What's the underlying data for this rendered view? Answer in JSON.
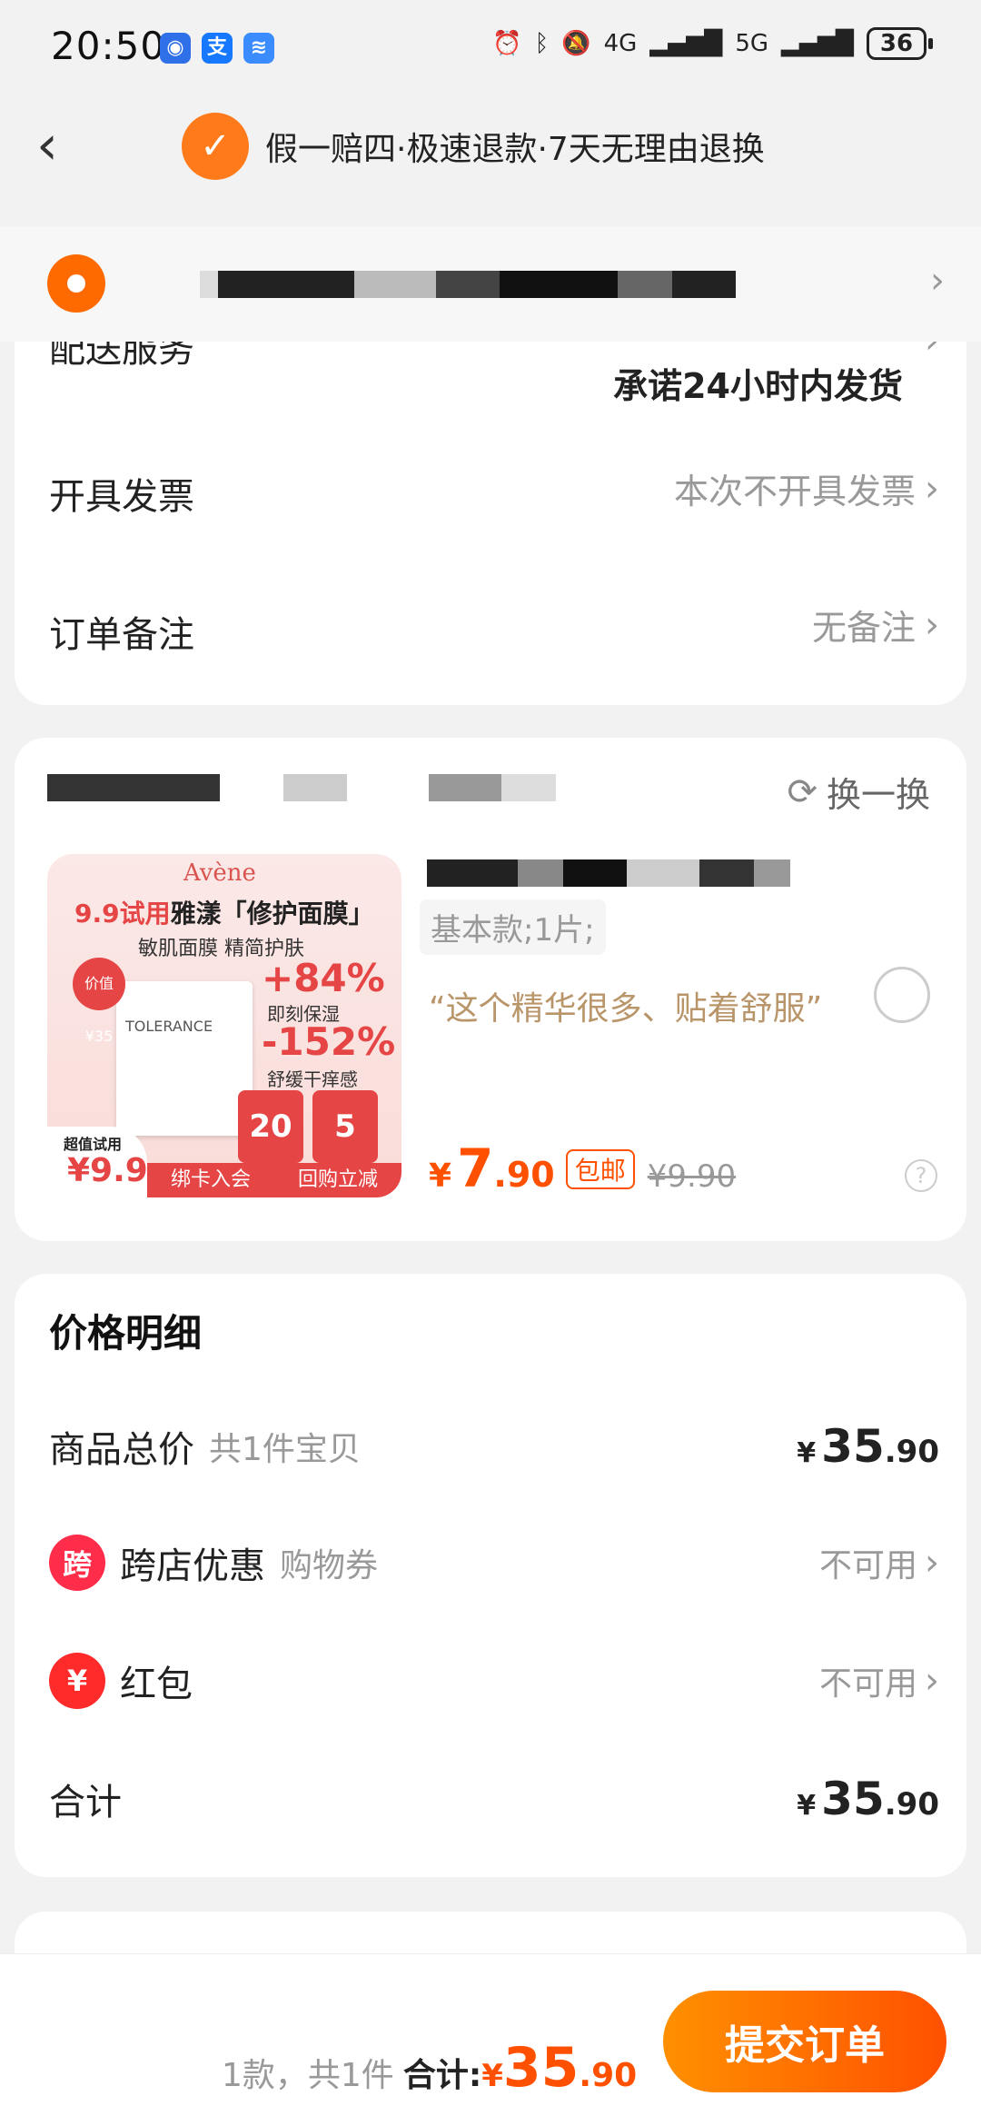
{
  "status_bar": {
    "time": "20:50",
    "network_labels": [
      "4G",
      "5G"
    ],
    "battery": "36",
    "icons": [
      "location-app-icon",
      "alipay-icon",
      "wifi-app-icon",
      "alarm-icon",
      "bluetooth-icon",
      "mute-icon",
      "signal-icon",
      "battery-icon"
    ]
  },
  "header": {
    "guarantee_text": "假一赔四·极速退款·7天无理由退换"
  },
  "delivery_card": {
    "clipped_label": "配送服务",
    "shipping_promise": "承诺24小时内发货",
    "invoice_label": "开具发票",
    "invoice_value": "本次不开具发票",
    "note_label": "订单备注",
    "note_value": "无备注"
  },
  "product_card": {
    "swap_label": "换一换",
    "image": {
      "brand": "Avène",
      "headline_prefix": "9.9试用",
      "headline_main": "雅漾「修护面膜」",
      "subtitle": "敏肌面膜 精简护肤",
      "stat1": "+84%",
      "stat1_label": "即刻保湿",
      "stat2": "-152%",
      "stat2_label": "舒缓干痒感",
      "box_text": "TOLERANCE",
      "price_tag": "价值¥35",
      "coupon1": "20",
      "coupon2": "5",
      "trial_label": "超值试用",
      "trial_value": "¥9.9",
      "footer_left": "绑卡入会",
      "footer_right": "回购立减"
    },
    "variant": "基本款;1片;",
    "review": "“这个精华很多、贴着舒服”",
    "price_yen": "¥",
    "price_int": "7",
    "price_dec": ".90",
    "free_shipping": "包邮",
    "original_price": "¥9.90"
  },
  "price_detail": {
    "title": "价格明细",
    "subtotal_label": "商品总价",
    "subtotal_sub": "共1件宝贝",
    "subtotal_yen": "¥",
    "subtotal_int": "35",
    "subtotal_dec": ".90",
    "cross_store_icon": "跨",
    "cross_store_label": "跨店优惠",
    "cross_store_sub": "购物券",
    "cross_store_value": "不可用",
    "red_packet_label": "红包",
    "red_packet_value": "不可用",
    "total_label": "合计",
    "total_yen": "¥",
    "total_int": "35",
    "total_dec": ".90"
  },
  "bottom_bar": {
    "count_text": "1款，共1件",
    "total_label": "合计:",
    "yen": "¥",
    "int": "35",
    "dec": ".90",
    "submit_label": "提交订单"
  },
  "colors": {
    "accent": "#ff5000",
    "button_gradient_start": "#ff9000",
    "review_text": "#b9956a",
    "badge_red": "#ff2d4a"
  }
}
